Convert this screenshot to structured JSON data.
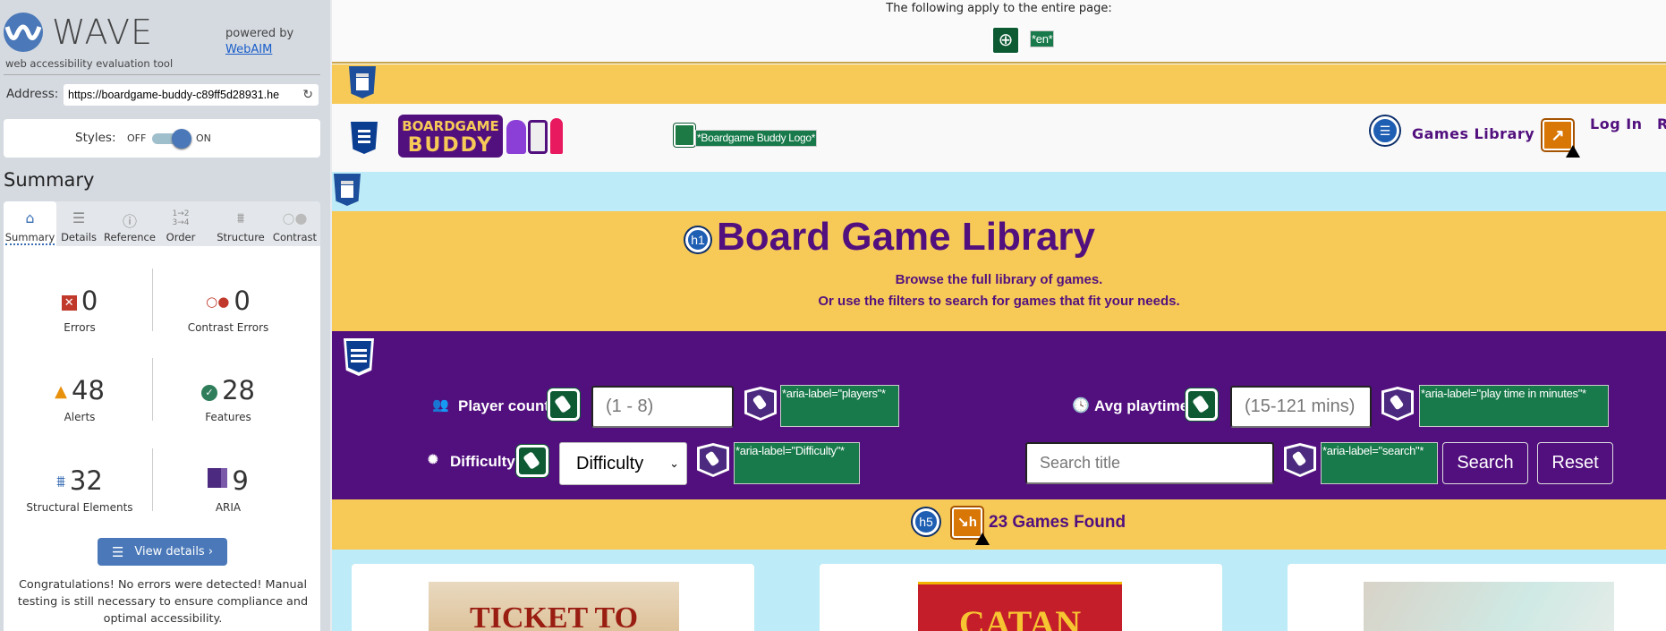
{
  "wave": {
    "logo_text": "WAVE",
    "tagline": "web accessibility evaluation tool",
    "powered_by": "powered by",
    "webaim_link": "WebAIM",
    "address_label": "Address:",
    "address_value": "https://boardgame-buddy-c89ff5d28931.he",
    "styles_label": "Styles:",
    "styles_off": "OFF",
    "styles_on": "ON",
    "styles_state": "on",
    "summary_heading": "Summary",
    "tabs": [
      {
        "label": "Summary",
        "icon": "home-icon",
        "active": true
      },
      {
        "label": "Details",
        "icon": "list-icon"
      },
      {
        "label": "Reference",
        "icon": "info-icon"
      },
      {
        "label": "Order",
        "icon": "order-icon"
      },
      {
        "label": "Structure",
        "icon": "structure-icon"
      },
      {
        "label": "Contrast",
        "icon": "contrast-icon"
      }
    ],
    "stats": [
      {
        "label": "Errors",
        "value": "0",
        "icon": "error-icon",
        "color": "#c0392b"
      },
      {
        "label": "Contrast Errors",
        "value": "0",
        "icon": "contrast-error-icon",
        "color": "#c0392b"
      },
      {
        "label": "Alerts",
        "value": "48",
        "icon": "alert-icon",
        "color": "#e8910c"
      },
      {
        "label": "Features",
        "value": "28",
        "icon": "feature-icon",
        "color": "#2f7d5b"
      },
      {
        "label": "Structural Elements",
        "value": "32",
        "icon": "structure-icon",
        "color": "#3a6fb5"
      },
      {
        "label": "ARIA",
        "value": "9",
        "icon": "aria-icon",
        "color": "#4b2a7f"
      }
    ],
    "view_details": "View details ›",
    "congrats": "Congratulations! No errors were detected! Manual testing is still necessary to ensure compliance and optimal accessibility."
  },
  "page": {
    "entire_page_note": "The following apply to the entire page:",
    "lang_label": "*en*",
    "logo_alt_label": "*Boardgame Buddy Logo*",
    "logo_text_line1": "BOARDGAME",
    "logo_text_line2": "BUDDY",
    "nav": {
      "games_library": "Games Library",
      "log_in": "Log In",
      "register_partial": "R"
    },
    "h1_badge": "h1",
    "title": "Board Game Library",
    "subtitle1": "Browse the full library of games.",
    "subtitle2": "Or use the filters to search for games that fit your needs.",
    "filters": {
      "player_count_label": "Player count",
      "player_count_placeholder": "(1 - 8)",
      "player_aria": "*aria-label=\"players\"*",
      "playtime_label": "Avg playtime",
      "playtime_placeholder": "(15-121 mins)",
      "playtime_aria": "*aria-label=\"play time in minutes\"*",
      "difficulty_label": "Difficulty",
      "difficulty_selected": "Difficulty",
      "difficulty_aria": "*aria-label=\"Difficulty\"*",
      "search_placeholder": "Search title",
      "search_aria": "*aria-label=\"search\"*",
      "search_button": "Search",
      "reset_button": "Reset"
    },
    "h5_badge": "h5",
    "results": "23 Games Found",
    "cards": [
      {
        "title": "TICKET TO RIDE"
      },
      {
        "title": "CATAN"
      },
      {
        "title": ""
      }
    ],
    "colors": {
      "purple": "#52107e",
      "yellow": "#f7ca57",
      "light_blue": "#bdebf7"
    }
  }
}
